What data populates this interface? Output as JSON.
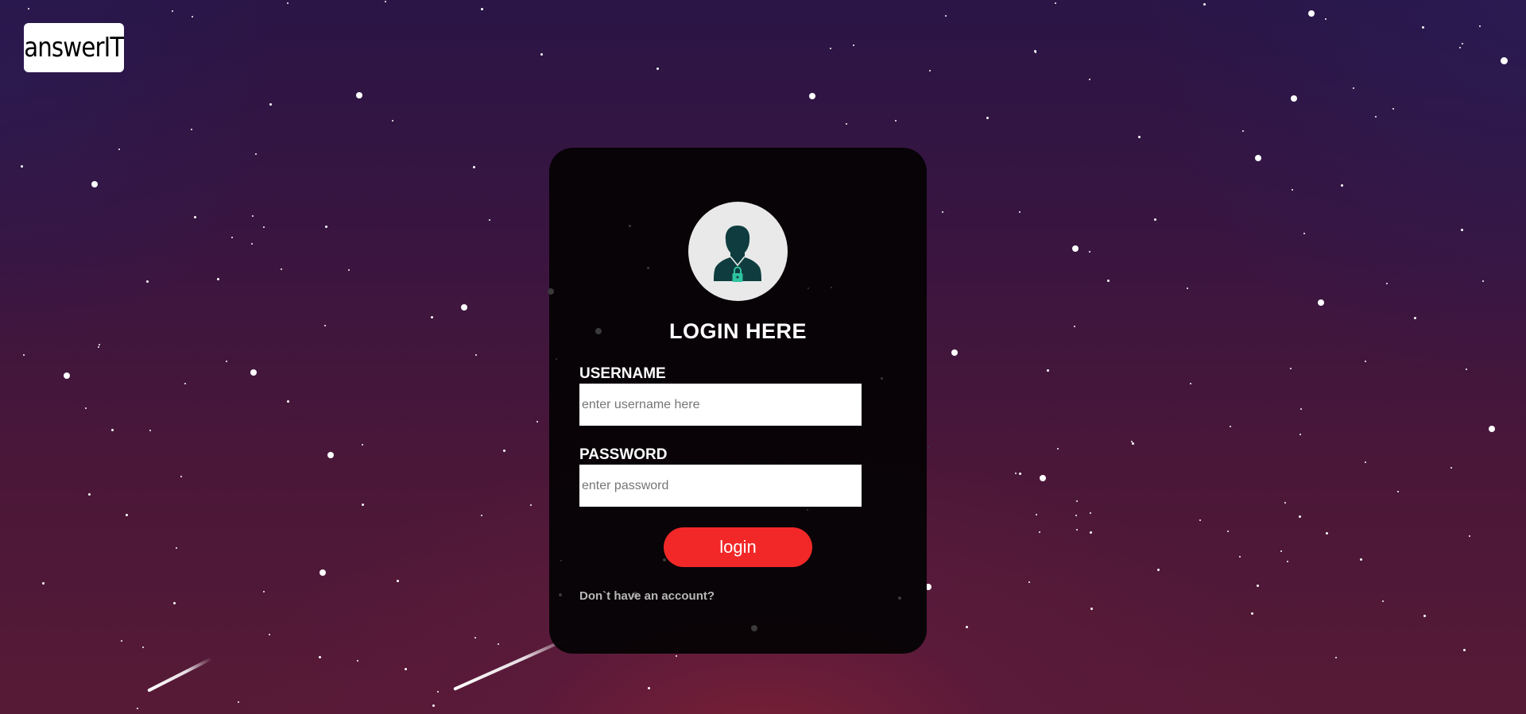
{
  "brand": {
    "logo_text": "answerIT"
  },
  "login_form": {
    "title": "LOGIN HERE",
    "username_label": "USERNAME",
    "username_placeholder": "enter username here",
    "password_label": "PASSWORD",
    "password_placeholder": "enter password",
    "login_button": "login",
    "signup_text": "Don`t have an account?"
  },
  "colors": {
    "accent": "#f22828",
    "card_background": "#060305",
    "avatar_circle": "#e9e9e9",
    "avatar_figure": "#0f3d3f",
    "lock_icon": "#2ec4a0"
  },
  "icons": {
    "avatar": "user-lock-icon"
  }
}
